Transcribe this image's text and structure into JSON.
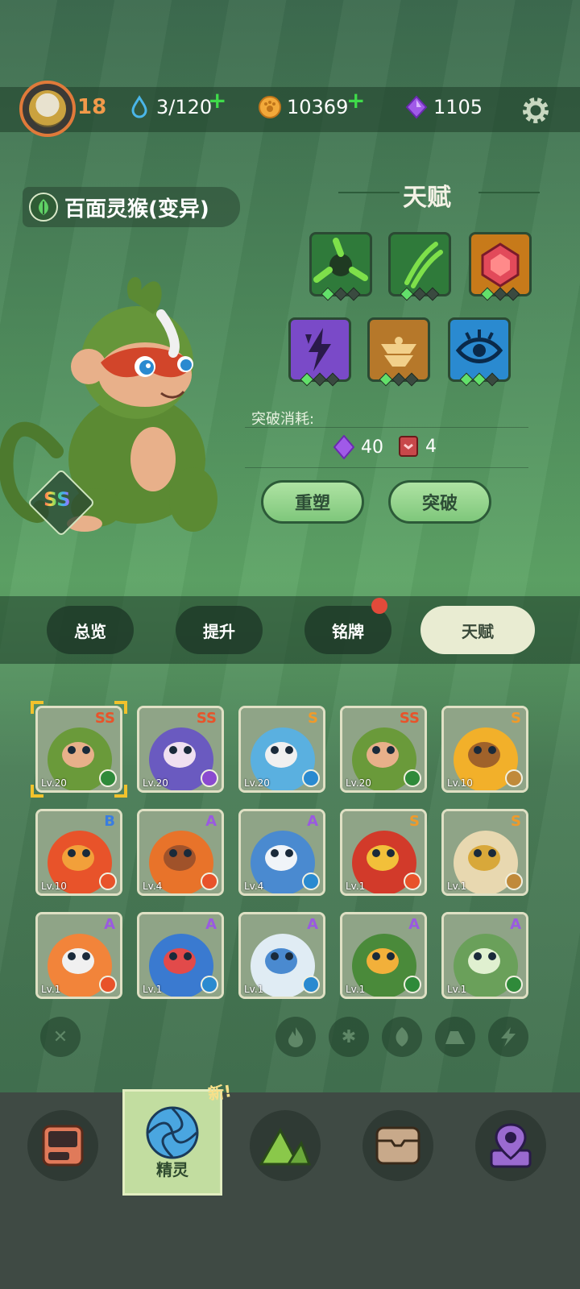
{
  "top_bar": {
    "level": "18",
    "stamina": "3/120",
    "coins": "10369",
    "gems": "1105"
  },
  "pet": {
    "name": "百面灵猴(变异)",
    "grade": "SS"
  },
  "talent_panel": {
    "title": "天赋",
    "cost_label": "突破消耗:",
    "gem_cost": "40",
    "book_cost": "4",
    "reshape_button": "重塑",
    "breakthrough_button": "突破",
    "tiles": [
      {
        "icon": "thorn-icon",
        "color": "#2f7a3a",
        "pips": 1
      },
      {
        "icon": "claw-icon",
        "color": "#2f7a3a",
        "pips": 1
      },
      {
        "icon": "gem-shield-icon",
        "color": "#c77a1a",
        "pips": 1
      },
      {
        "icon": "lightning-icon",
        "color": "#7a4ac8",
        "pips": 1
      },
      {
        "icon": "bowl-icon",
        "color": "#b6782a",
        "pips": 1
      },
      {
        "icon": "eye-icon",
        "color": "#2a8ad0",
        "pips": 2
      }
    ]
  },
  "tabs": [
    {
      "label": "总览",
      "active": false
    },
    {
      "label": "提升",
      "active": false
    },
    {
      "label": "铭牌",
      "active": false,
      "badge": true
    },
    {
      "label": "天赋",
      "active": true
    }
  ],
  "cards": [
    {
      "grade": "SS",
      "level": "Lv.20",
      "type": "grass",
      "art": "monkey",
      "selected": true
    },
    {
      "grade": "SS",
      "level": "Lv.20",
      "type": "electric",
      "art": "purple-rat"
    },
    {
      "grade": "S",
      "level": "Lv.20",
      "type": "ice",
      "art": "blue-deer"
    },
    {
      "grade": "SS",
      "level": "Lv.20",
      "type": "grass",
      "art": "monkey"
    },
    {
      "grade": "S",
      "level": "Lv.10",
      "type": "earth",
      "art": "sunflower"
    },
    {
      "grade": "B",
      "level": "Lv.10",
      "type": "fire",
      "art": "fire-imp"
    },
    {
      "grade": "A",
      "level": "Lv.4",
      "type": "fire",
      "art": "lava-blob"
    },
    {
      "grade": "A",
      "level": "Lv.4",
      "type": "ice",
      "art": "snow-yeti"
    },
    {
      "grade": "S",
      "level": "Lv.1",
      "type": "fire",
      "art": "red-horn"
    },
    {
      "grade": "S",
      "level": "Lv.1",
      "type": "earth",
      "art": "skull-dino"
    },
    {
      "grade": "A",
      "level": "Lv.1",
      "type": "fire",
      "art": "fire-fox"
    },
    {
      "grade": "A",
      "level": "Lv.1",
      "type": "ice",
      "art": "blue-fish"
    },
    {
      "grade": "A",
      "level": "Lv.1",
      "type": "ice",
      "art": "white-tiger"
    },
    {
      "grade": "A",
      "level": "Lv.1",
      "type": "grass",
      "art": "cactus"
    },
    {
      "grade": "A",
      "level": "Lv.1",
      "type": "grass",
      "art": "leaf-rabbit"
    }
  ],
  "filters": [
    "clear-filter-icon",
    "fire-filter-icon",
    "ice-filter-icon",
    "grass-filter-icon",
    "earth-filter-icon",
    "electric-filter-icon"
  ],
  "bottom_nav": {
    "active_label": "精灵",
    "new_tag": "新!",
    "items": [
      "device-icon",
      "sprite-portal-icon",
      "mountain-icon",
      "chest-icon",
      "map-pin-icon"
    ]
  },
  "colors": {
    "grade_SS": "#e8532a",
    "grade_S": "#f09a2a",
    "grade_A": "#9a5ae0",
    "grade_B": "#3a7de0",
    "type_grass": "#2f8a3a",
    "type_fire": "#e8532a",
    "type_ice": "#2a8ad0",
    "type_electric": "#8a4ad0",
    "type_earth": "#c08a3a"
  }
}
